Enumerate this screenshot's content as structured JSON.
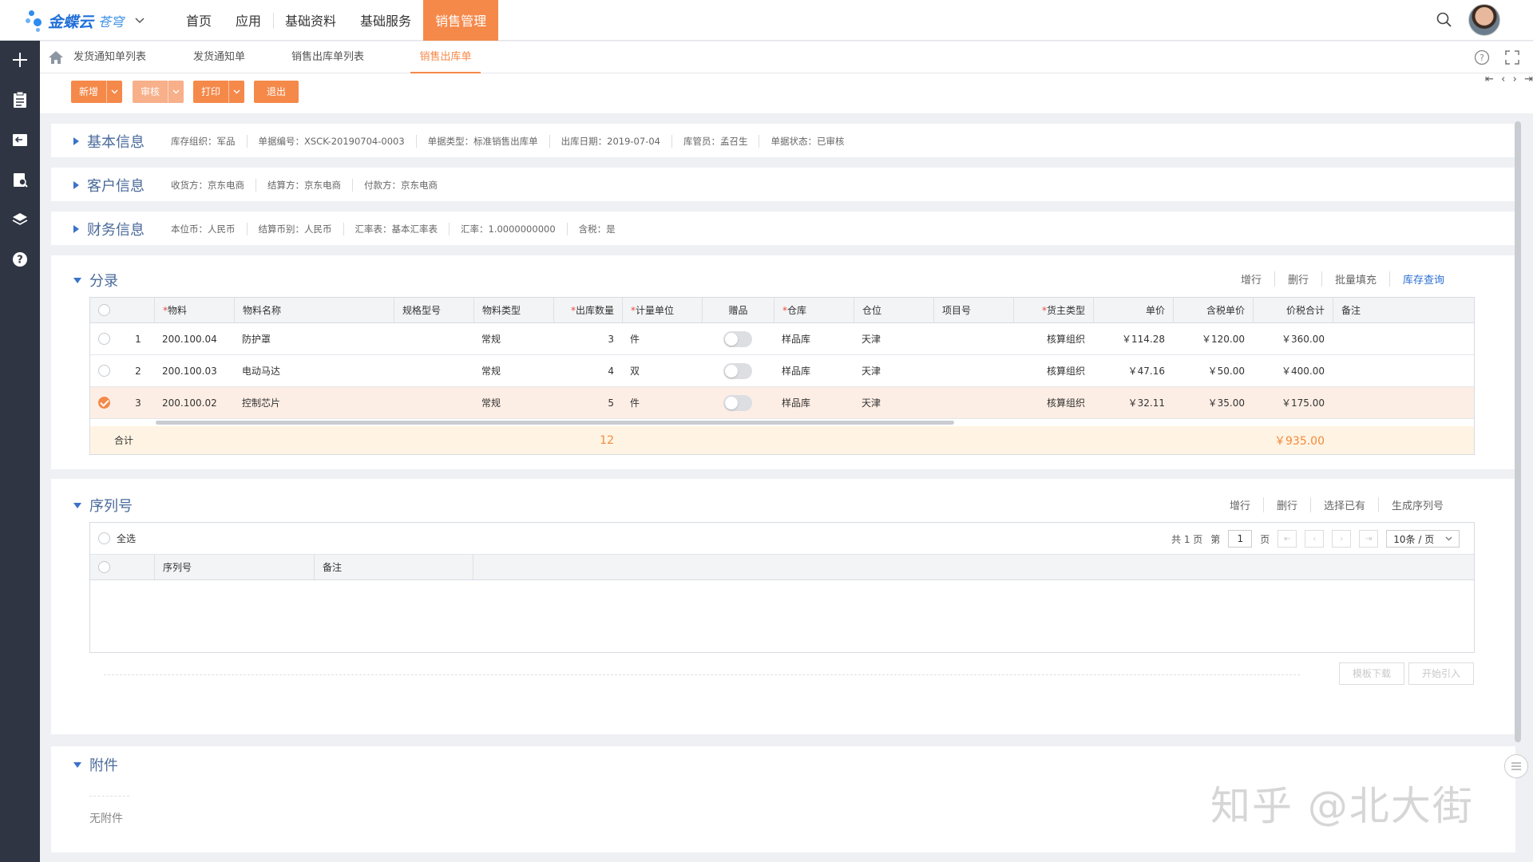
{
  "app": {
    "logo_text": "金蝶云",
    "logo_sub": "苍穹",
    "nav": [
      "首页",
      "应用",
      "基础资料",
      "基础服务",
      "销售管理"
    ],
    "active_nav": "销售管理"
  },
  "tabs": [
    "发货通知单列表",
    "发货通知单",
    "销售出库单列表",
    "销售出库单"
  ],
  "active_tab": "销售出库单",
  "toolbar": {
    "new_label": "新增",
    "audit_label": "审核",
    "print_label": "打印",
    "exit_label": "退出"
  },
  "basic_info": {
    "title": "基本信息",
    "items": [
      "库存组织：军品",
      "单据编号：XSCK-20190704-0003",
      "单据类型：标准销售出库单",
      "出库日期：2019-07-04",
      "库管员：孟召生",
      "单据状态：已审核"
    ]
  },
  "customer_info": {
    "title": "客户信息",
    "items": [
      "收货方：京东电商",
      "结算方：京东电商",
      "付款方：京东电商"
    ]
  },
  "finance_info": {
    "title": "财务信息",
    "items": [
      "本位币：人民币",
      "结算币别：人民币",
      "汇率表：基本汇率表",
      "汇率：1.0000000000",
      "含税：是"
    ]
  },
  "entries": {
    "title": "分录",
    "actions": [
      "增行",
      "删行",
      "批量填充",
      "库存查询"
    ],
    "columns": [
      "物料",
      "物料名称",
      "规格型号",
      "物料类型",
      "出库数量",
      "计量单位",
      "赠品",
      "仓库",
      "仓位",
      "项目号",
      "货主类型",
      "单价",
      "含税单价",
      "价税合计",
      "备注"
    ],
    "rows": [
      {
        "no": "1",
        "material": "200.100.04",
        "name": "防护罩",
        "type": "常规",
        "qty": "3",
        "unit": "件",
        "warehouse": "样品库",
        "location": "天津",
        "owner_type": "核算组织",
        "price": "￥114.28",
        "tax_price": "￥120.00",
        "total": "￥360.00",
        "selected": false
      },
      {
        "no": "2",
        "material": "200.100.03",
        "name": "电动马达",
        "type": "常规",
        "qty": "4",
        "unit": "双",
        "warehouse": "样品库",
        "location": "天津",
        "owner_type": "核算组织",
        "price": "￥47.16",
        "tax_price": "￥50.00",
        "total": "￥400.00",
        "selected": false
      },
      {
        "no": "3",
        "material": "200.100.02",
        "name": "控制芯片",
        "type": "常规",
        "qty": "5",
        "unit": "件",
        "warehouse": "样品库",
        "location": "天津",
        "owner_type": "核算组织",
        "price": "￥32.11",
        "tax_price": "￥35.00",
        "total": "￥175.00",
        "selected": true
      }
    ],
    "footer": {
      "label": "合计",
      "qty": "12",
      "total": "￥935.00"
    }
  },
  "serials": {
    "title": "序列号",
    "actions": [
      "增行",
      "删行",
      "选择已有",
      "生成序列号"
    ],
    "select_all": "全选",
    "pager": {
      "total": "共 1 页",
      "page_prefix": "第",
      "page": "1",
      "page_suffix": "页",
      "size": "10条 / 页"
    },
    "columns": [
      "序列号",
      "备注"
    ],
    "template_download": "模板下载",
    "start_import": "开始引入"
  },
  "attachments": {
    "title": "附件",
    "empty": "无附件"
  },
  "watermark": "知乎 @北大街",
  "colors": {
    "accent": "#f5894a",
    "rail": "#2f3543",
    "link": "#2d6fd0"
  }
}
